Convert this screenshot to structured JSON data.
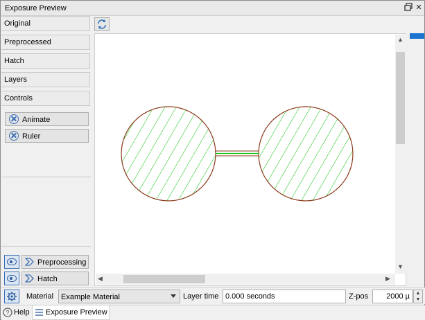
{
  "window": {
    "title": "Exposure Preview"
  },
  "nav": [
    {
      "label": "Original"
    },
    {
      "label": "Preprocessed"
    },
    {
      "label": "Hatch"
    },
    {
      "label": "Layers"
    },
    {
      "label": "Controls"
    }
  ],
  "controls": {
    "animate_label": "Animate",
    "ruler_label": "Ruler"
  },
  "stages": {
    "preprocessing_label": "Preprocessing",
    "hatch_label": "Hatch"
  },
  "bottom": {
    "material_label": "Material",
    "material_value": "Example Material",
    "layer_time_label": "Layer time",
    "layer_time_value": "0.000 seconds",
    "zpos_label": "Z-pos",
    "zpos_value": "2000 µ"
  },
  "tabs": [
    {
      "label": "Help",
      "active": false
    },
    {
      "label": "Exposure Preview",
      "active": true
    }
  ],
  "colors": {
    "accent": "#1a74d0",
    "hatch_fill": "#00c000",
    "outline": "#8b3a1a"
  },
  "icons": {
    "float": "float-window-icon",
    "close": "close-icon",
    "refresh": "refresh-icon",
    "visibility": "eye-icon",
    "settings": "gear-icon"
  }
}
